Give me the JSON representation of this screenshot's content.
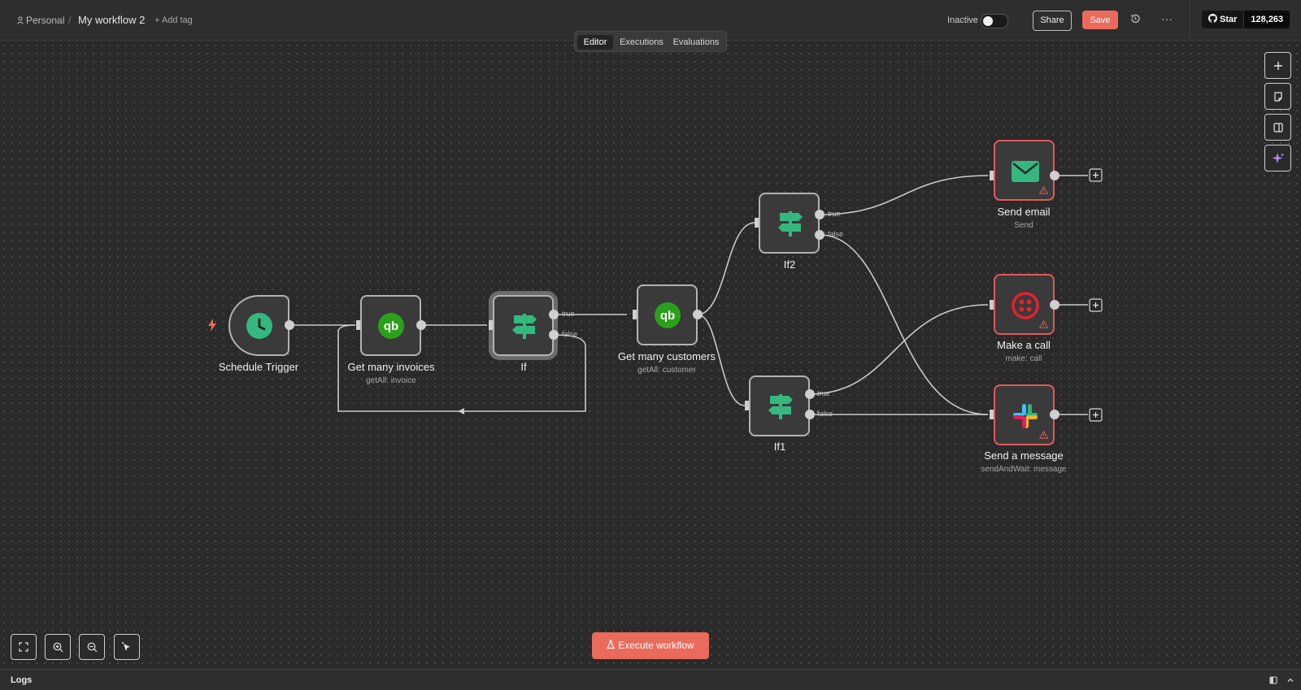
{
  "header": {
    "breadcrumb_project": "Personal",
    "workflow_name": "My workflow 2",
    "add_tag": "+ Add tag",
    "status_label": "Inactive",
    "share_label": "Share",
    "save_label": "Save",
    "more_label": "···",
    "github_star_label": "Star",
    "github_star_count": "128,263"
  },
  "tabs": [
    {
      "label": "Editor",
      "active": true
    },
    {
      "label": "Executions",
      "active": false
    },
    {
      "label": "Evaluations",
      "active": false
    }
  ],
  "nodes": {
    "schedule": {
      "title": "Schedule Trigger",
      "icon": "clock-icon"
    },
    "invoices": {
      "title": "Get many invoices",
      "subtitle": "getAll: invoice",
      "icon": "quickbooks-icon"
    },
    "if": {
      "title": "If",
      "icon": "signpost-icon"
    },
    "customers": {
      "title": "Get many customers",
      "subtitle": "getAll: customer",
      "icon": "quickbooks-icon"
    },
    "if2": {
      "title": "If2",
      "icon": "signpost-icon"
    },
    "if1": {
      "title": "If1",
      "icon": "signpost-icon"
    },
    "email": {
      "title": "Send email",
      "subtitle": "Send",
      "icon": "envelope-icon",
      "warning": true
    },
    "call": {
      "title": "Make a call",
      "subtitle": "make: call",
      "icon": "twilio-icon",
      "warning": true
    },
    "message": {
      "title": "Send a message",
      "subtitle": "sendAndWait: message",
      "icon": "slack-icon",
      "warning": true
    }
  },
  "branch_labels": {
    "true": "true",
    "false": "false"
  },
  "execute_label": "Execute workflow",
  "logs_label": "Logs",
  "colors": {
    "accent": "#ea6b5b",
    "error_border": "#e05a5a",
    "node_green": "#35b87f",
    "qb_green": "#2ca01c"
  }
}
